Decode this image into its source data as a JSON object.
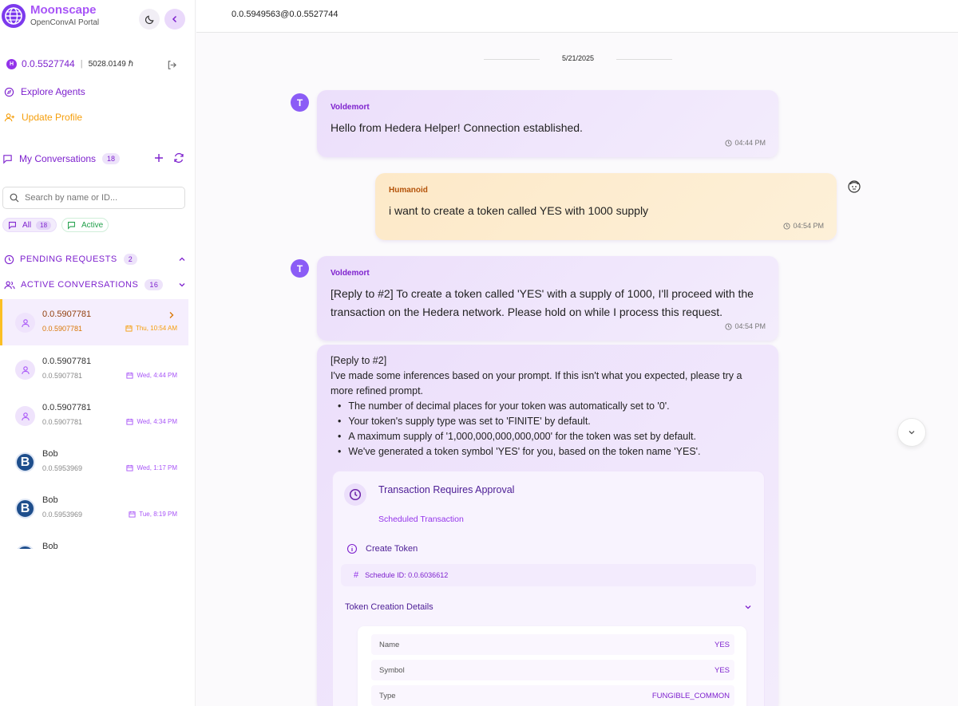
{
  "brand": {
    "name": "Moonscape",
    "subtitle": "OpenConvAI Portal"
  },
  "account": {
    "badge": "H",
    "id": "0.0.5527744",
    "separator": "|",
    "balance": "5028.0149 ℏ"
  },
  "nav": {
    "explore": "Explore Agents",
    "update_profile": "Update Profile"
  },
  "conversations": {
    "title": "My Conversations",
    "count": "18",
    "search_placeholder": "Search by name or ID...",
    "filters": {
      "all_label": "All",
      "all_count": "18",
      "active_label": "Active"
    },
    "pending": {
      "label": "PENDING REQUESTS",
      "count": "2"
    },
    "active": {
      "label": "ACTIVE CONVERSATIONS",
      "count": "16"
    },
    "items": [
      {
        "name": "0.0.5907781",
        "sub": "0.0.5907781",
        "time": "Thu, 10:54 AM"
      },
      {
        "name": "0.0.5907781",
        "sub": "0.0.5907781",
        "time": "Wed, 4:44 PM"
      },
      {
        "name": "0.0.5907781",
        "sub": "0.0.5907781",
        "time": "Wed, 4:34 PM"
      },
      {
        "name": "Bob",
        "sub": "0.0.5953969",
        "time": "Wed, 1:17 PM"
      },
      {
        "name": "Bob",
        "sub": "0.0.5953969",
        "time": "Tue, 8:19 PM"
      },
      {
        "name": "Bob",
        "sub": "",
        "time": ""
      }
    ]
  },
  "topbar": {
    "title": "0.0.5949563@0.0.5527744"
  },
  "chat": {
    "date": "5/21/2025",
    "messages": [
      {
        "avatar": "T",
        "sender": "Voldemort",
        "text": "Hello from Hedera Helper! Connection established.",
        "time": "04:44 PM"
      },
      {
        "sender": "Humanoid",
        "text": "i want to create a token called YES with 1000 supply",
        "time": "04:54 PM"
      },
      {
        "avatar": "T",
        "sender": "Voldemort",
        "text": "[Reply to #2] To create a token called 'YES' with a supply of 1000, I'll proceed with the transaction on the Hedera network. Please hold on while I process this request.",
        "time": "04:54 PM"
      }
    ],
    "reply": {
      "header": "[Reply to #2]",
      "intro_1": "I've made some inferences based on your prompt. If this isn't what you expected, please try a",
      "intro_2": "more refined prompt.",
      "bullets": [
        "The number of decimal places for your token was automatically set to '0'.",
        "Your token's supply type was set to 'FINITE' by default.",
        "A maximum supply of '1,000,000,000,000,000' for the token was set by default.",
        "We've generated a token symbol 'YES' for you, based on the token name 'YES'."
      ],
      "tx": {
        "title": "Transaction Requires Approval",
        "subtitle": "Scheduled Transaction",
        "action": "Create Token",
        "schedule": "Schedule ID: 0.0.6036612",
        "details_label": "Token Creation Details",
        "rows": [
          {
            "key": "Name",
            "value": "YES"
          },
          {
            "key": "Symbol",
            "value": "YES"
          },
          {
            "key": "Type",
            "value": "FUNGIBLE_COMMON"
          }
        ]
      }
    }
  },
  "colors": {
    "accent": "#7e22ce",
    "human_bubble": "#fde9c8",
    "agent_bubble": "#ecdffb",
    "selected_bar": "#fbbf24"
  }
}
